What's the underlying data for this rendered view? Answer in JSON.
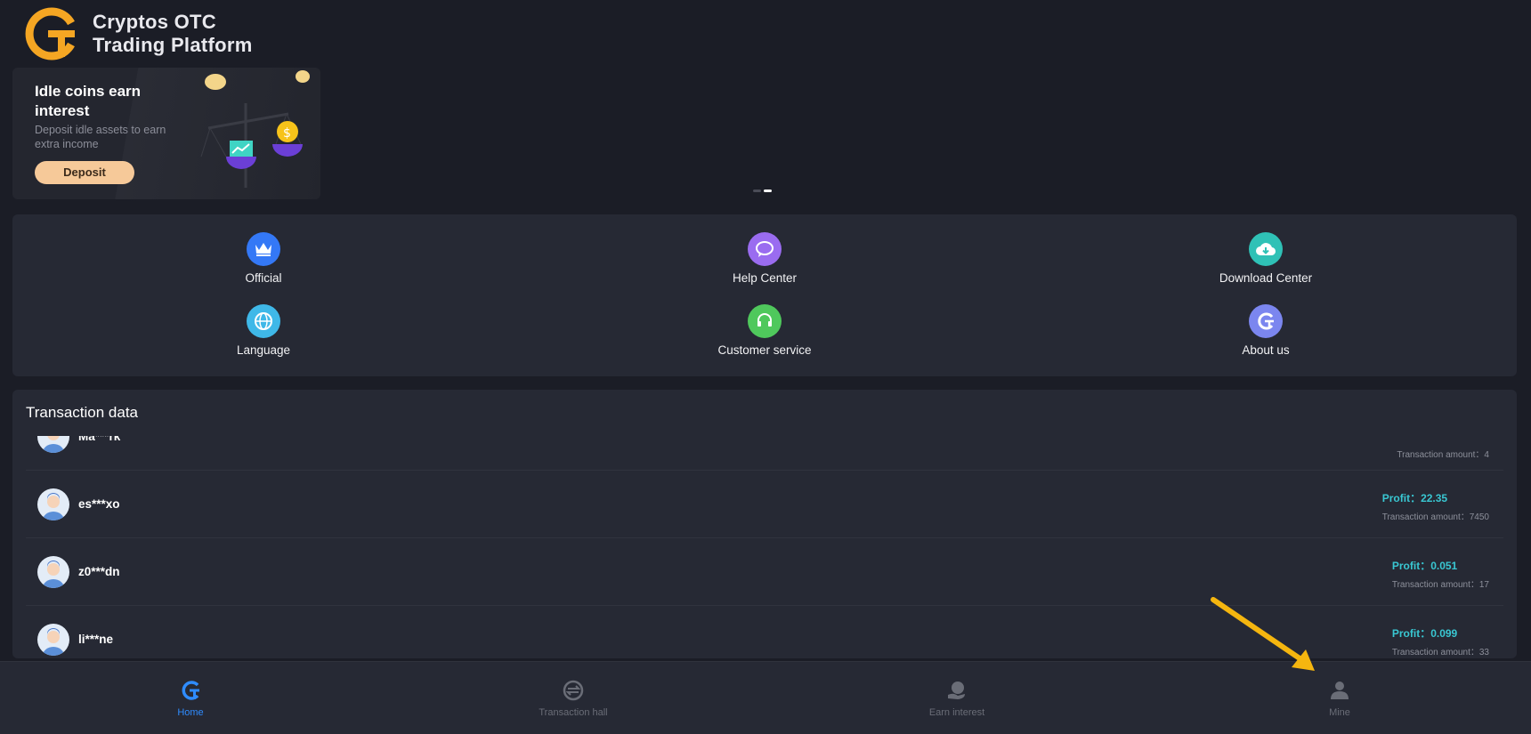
{
  "header": {
    "brand_line1": "Cryptos OTC",
    "brand_line2": "Trading Platform"
  },
  "banner": {
    "title": "Idle coins earn interest",
    "subtitle": "Deposit idle assets to earn extra income",
    "button": "Deposit"
  },
  "menu": {
    "items": [
      {
        "label": "Official",
        "icon": "crown-icon",
        "color": "#3478f6"
      },
      {
        "label": "Help Center",
        "icon": "chat-bubble-icon",
        "color": "#9a6cf0"
      },
      {
        "label": "Download Center",
        "icon": "cloud-download-icon",
        "color": "#2fc1b6"
      },
      {
        "label": "Language",
        "icon": "globe-icon",
        "color": "#3fb8e8"
      },
      {
        "label": "Customer service",
        "icon": "headset-icon",
        "color": "#4fc85c"
      },
      {
        "label": "About us",
        "icon": "logo-g-icon",
        "color": "#7b86ef"
      }
    ]
  },
  "transactions": {
    "title": "Transaction data",
    "rows": [
      {
        "name": "Ma***rk",
        "profit_label": "",
        "amount_label": "Transaction amount：4"
      },
      {
        "name": "es***xo",
        "profit_label": "Profit：22.35",
        "amount_label": "Transaction amount：7450"
      },
      {
        "name": "z0***dn",
        "profit_label": "Profit：0.051",
        "amount_label": "Transaction amount：17"
      },
      {
        "name": "li***ne",
        "profit_label": "Profit：0.099",
        "amount_label": "Transaction amount：33"
      }
    ]
  },
  "nav": {
    "items": [
      {
        "label": "Home",
        "icon": "logo-g-icon",
        "active": true
      },
      {
        "label": "Transaction hall",
        "icon": "exchange-icon",
        "active": false
      },
      {
        "label": "Earn interest",
        "icon": "coin-hand-icon",
        "active": false
      },
      {
        "label": "Mine",
        "icon": "user-icon",
        "active": false
      }
    ]
  },
  "colors": {
    "accent": "#2f8cff",
    "profit": "#39c7d2",
    "annotation_arrow": "#f5b60f"
  }
}
